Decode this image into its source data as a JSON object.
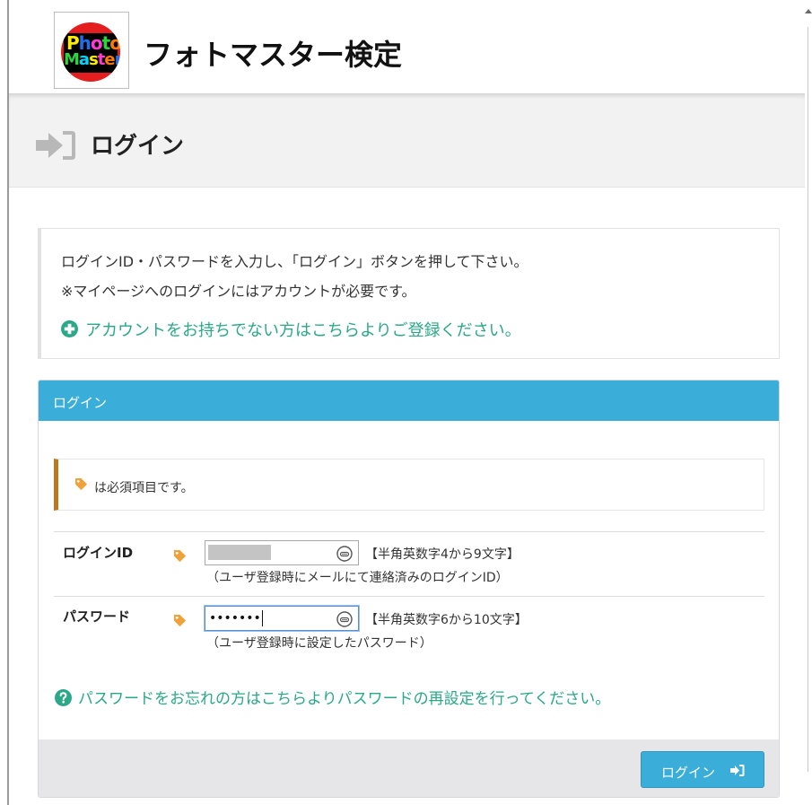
{
  "header": {
    "logo_text": {
      "photo": "Photo",
      "master": "Master"
    },
    "site_title": "フォトマスター検定"
  },
  "page_title": "ログイン",
  "info": {
    "line1": "ログインID・パスワードを入力し、「ログイン」ボタンを押して下さい。",
    "line2": "※マイページへのログインにはアカウントが必要です。",
    "register_link": "アカウントをお持ちでない方はこちらよりご登録ください。"
  },
  "panel": {
    "title": "ログイン",
    "required_note": "は必須項目です。",
    "login_id": {
      "label": "ログインID",
      "rule": "【半角英数字4から9文字】",
      "note": "（ユーザ登録時にメールにて連絡済みのログインID）"
    },
    "password": {
      "label": "パスワード",
      "value_mask": "•••••••",
      "rule": "【半角英数字6から10文字】",
      "note": "（ユーザ登録時に設定したパスワード）"
    },
    "forgot_link": "パスワードをお忘れの方はこちらよりパスワードの再設定を行ってください。",
    "submit_label": "ログイン"
  },
  "colors": {
    "panel_header": "#3aaed8",
    "link_green": "#2aa888",
    "required_tag": "#f0a23a",
    "required_bar": "#b87a1c",
    "footer_bg": "#e6e6e8"
  },
  "icons": {
    "title_icon": "sign-in-icon",
    "register_icon": "plus-circle-icon",
    "required_icon": "tag-icon",
    "input_icon": "password-manager-icon",
    "forgot_icon": "question-circle-icon",
    "button_icon": "sign-in-icon"
  }
}
